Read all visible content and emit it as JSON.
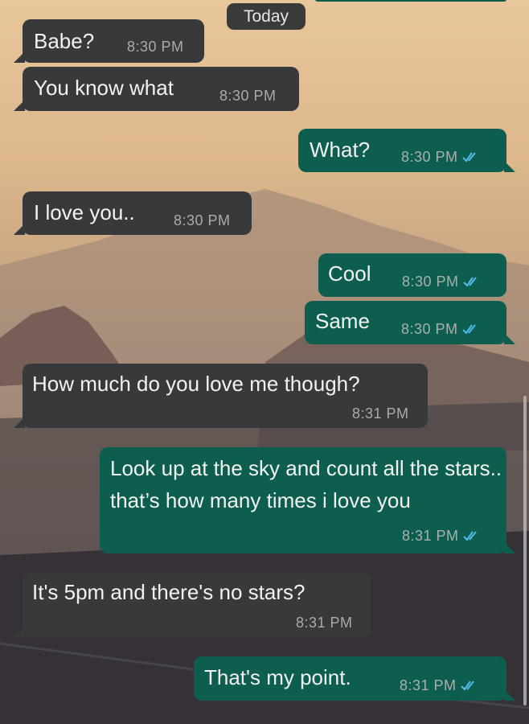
{
  "chat": {
    "date_label": "Today",
    "messages": [
      {
        "text": "Babe?",
        "time": "8:30 PM",
        "direction": "incoming"
      },
      {
        "text": "You know what",
        "time": "8:30 PM",
        "direction": "incoming"
      },
      {
        "text": "What?",
        "time": "8:30 PM",
        "direction": "outgoing",
        "status": "read-double-check"
      },
      {
        "text": "I love you..",
        "time": "8:30 PM",
        "direction": "incoming"
      },
      {
        "text": "Cool",
        "time": "8:30 PM",
        "direction": "outgoing",
        "status": "read-double-check"
      },
      {
        "text": "Same",
        "time": "8:30 PM",
        "direction": "outgoing",
        "status": "read-double-check"
      },
      {
        "text": "How much do you love me though?",
        "time": "8:31 PM",
        "direction": "incoming"
      },
      {
        "text": "Look up at the sky and count all the stars.. that’s how many times i love you",
        "time": "8:31 PM",
        "direction": "outgoing",
        "status": "read-double-check"
      },
      {
        "text": "It's 5pm and there's no stars?",
        "time": "8:31 PM",
        "direction": "incoming"
      },
      {
        "text": "That's my point.",
        "time": "8:31 PM",
        "direction": "outgoing",
        "status": "read-double-check"
      }
    ]
  },
  "colors": {
    "incoming_bubble": "#37393b",
    "outgoing_bubble": "#0d5e4f",
    "read_tick": "#53bdeb"
  }
}
